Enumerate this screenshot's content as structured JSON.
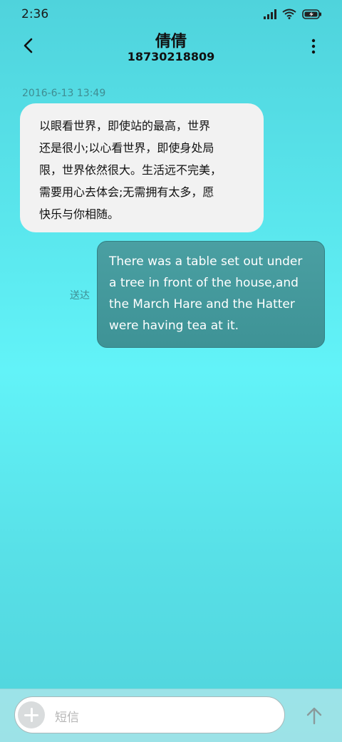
{
  "status_bar": {
    "time": "2:36",
    "icons": [
      "signal-icon",
      "wifi-icon",
      "battery-charging-icon"
    ]
  },
  "header": {
    "contact_name": "倩倩",
    "phone_number": "18730218809",
    "back_icon": "chevron-left-icon",
    "menu_icon": "more-vertical-icon"
  },
  "messages": {
    "timestamp": "2016-6-13 13:49",
    "incoming": {
      "lines": [
        "以眼看世界，即使站的最高，世界",
        "还是很小;以心看世界，即使身处局",
        "限，世界依然很大。生活远不完美，",
        "需要用心去体会;无需拥有太多，愿",
        "快乐与你相随。"
      ]
    },
    "outgoing": {
      "lines": [
        "There was a table set out under",
        "a tree in front of the house,and",
        "the March Hare and the Hatter",
        "were having tea at it."
      ],
      "status": "送达"
    }
  },
  "composer": {
    "placeholder": "短信",
    "add_icon": "plus-icon",
    "send_icon": "arrow-up-icon"
  },
  "colors": {
    "incoming_bubble": "#f2f2f2",
    "outgoing_bubble": "#4a9fa2",
    "accent_text": "#3f8d92"
  }
}
